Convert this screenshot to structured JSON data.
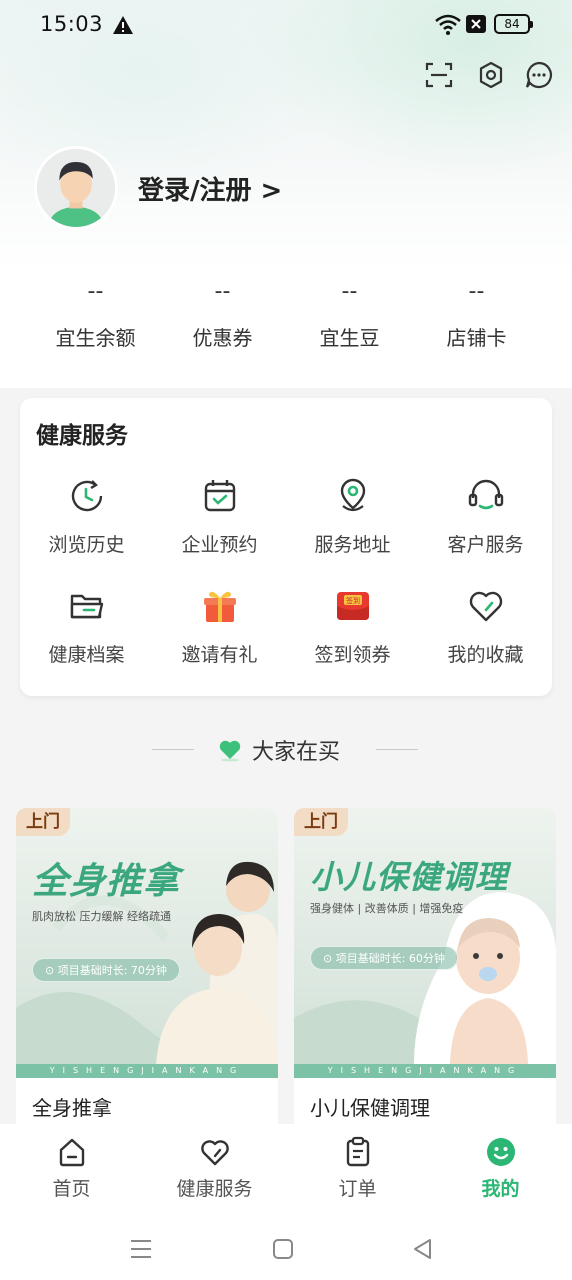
{
  "status_bar": {
    "time": "15:03",
    "battery": "84"
  },
  "top_icons": [
    "scan-icon",
    "settings-icon",
    "message-icon"
  ],
  "profile": {
    "login_label": "登录/注册 >"
  },
  "stats": [
    {
      "value": "--",
      "label": "宜生余额"
    },
    {
      "value": "--",
      "label": "优惠券"
    },
    {
      "value": "--",
      "label": "宜生豆"
    },
    {
      "value": "--",
      "label": "店铺卡"
    }
  ],
  "health_services": {
    "title": "健康服务",
    "items": [
      {
        "label": "浏览历史",
        "icon": "history-clock-icon"
      },
      {
        "label": "企业预约",
        "icon": "calendar-check-icon"
      },
      {
        "label": "服务地址",
        "icon": "location-pin-icon"
      },
      {
        "label": "客户服务",
        "icon": "headset-icon"
      },
      {
        "label": "健康档案",
        "icon": "folder-icon"
      },
      {
        "label": "邀请有礼",
        "icon": "gift-icon"
      },
      {
        "label": "签到领券",
        "icon": "checkin-envelope-icon",
        "badge": "签到"
      },
      {
        "label": "我的收藏",
        "icon": "heart-icon"
      }
    ]
  },
  "section": {
    "title": "大家在买"
  },
  "products": [
    {
      "badge": "上门",
      "big_title": "全身推拿",
      "tags": "肌肉放松    压力缓解    经络疏通",
      "pill": "⊙ 项目基础时长: 70分钟",
      "band": "YISHENGJIANKANG",
      "name": "全身推拿"
    },
    {
      "badge": "上门",
      "big_title": "小儿保健调理",
      "tags": "强身健体 | 改善体质 | 增强免疫",
      "pill": "⊙ 项目基础时长: 60分钟",
      "band": "YISHENGJIANKANG",
      "name": "小儿保健调理"
    }
  ],
  "tabbar": [
    {
      "label": "首页",
      "icon": "home-icon"
    },
    {
      "label": "健康服务",
      "icon": "heart-icon"
    },
    {
      "label": "订单",
      "icon": "clipboard-icon"
    },
    {
      "label": "我的",
      "icon": "smile-icon",
      "active": true
    }
  ],
  "colors": {
    "accent": "#2bb673",
    "badge_bg": "#f3dcc5"
  }
}
